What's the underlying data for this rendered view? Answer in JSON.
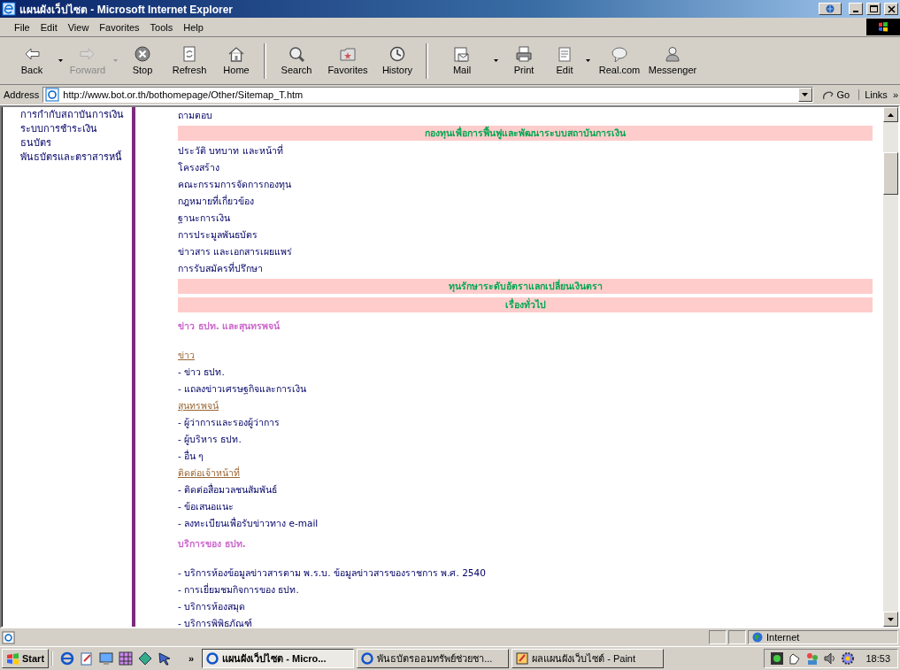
{
  "window": {
    "title": "แผนผังเว็ปไซต - Microsoft Internet Explorer"
  },
  "menu": [
    "File",
    "Edit",
    "View",
    "Favorites",
    "Tools",
    "Help"
  ],
  "toolbar": {
    "buttons": [
      {
        "label": "Back",
        "disabled": false,
        "dropdown": true
      },
      {
        "label": "Forward",
        "disabled": true,
        "dropdown": true
      },
      {
        "label": "Stop",
        "disabled": false,
        "dropdown": false
      },
      {
        "label": "Refresh",
        "disabled": false,
        "dropdown": false
      },
      {
        "label": "Home",
        "disabled": false,
        "dropdown": false
      },
      {
        "label": "Search",
        "disabled": false,
        "dropdown": false
      },
      {
        "label": "Favorites",
        "disabled": false,
        "dropdown": false
      },
      {
        "label": "History",
        "disabled": false,
        "dropdown": false
      },
      {
        "label": "Mail",
        "disabled": false,
        "dropdown": true
      },
      {
        "label": "Print",
        "disabled": false,
        "dropdown": false
      },
      {
        "label": "Edit",
        "disabled": false,
        "dropdown": true
      },
      {
        "label": "Real.com",
        "disabled": false,
        "dropdown": false
      },
      {
        "label": "Messenger",
        "disabled": false,
        "dropdown": false
      }
    ]
  },
  "address": {
    "label": "Address",
    "url": "http://www.bot.or.th/bothomepage/Other/Sitemap_T.htm",
    "go": "Go",
    "links": "Links",
    "links_more": "»"
  },
  "sidebar": {
    "items": [
      "การกำกับสถาบันการเงิน",
      "ระบบการชำระเงิน",
      "ธนบัตร",
      "พันธบัตรและตราสารหนี้"
    ]
  },
  "content": [
    {
      "kind": "text",
      "text": "ถามตอบ"
    },
    {
      "kind": "band",
      "text": "กองทุนเพื่อการฟื้นฟูและพัฒนาระบบสถาบันการเงิน"
    },
    {
      "kind": "text",
      "text": "ประวัติ บทบาท และหน้าที่"
    },
    {
      "kind": "text",
      "text": "โครงสร้าง"
    },
    {
      "kind": "text",
      "text": "คณะกรรมการจัดการกองทุน"
    },
    {
      "kind": "text",
      "text": "กฎหมายที่เกี่ยวข้อง"
    },
    {
      "kind": "text",
      "text": "ฐานะการเงิน"
    },
    {
      "kind": "text",
      "text": "การประมูลพันธบัตร"
    },
    {
      "kind": "text",
      "text": "ข่าวสาร และเอกสารเผยแพร่"
    },
    {
      "kind": "text",
      "text": "การรับสมัครที่ปรึกษา"
    },
    {
      "kind": "band",
      "text": "ทุนรักษาระดับอัตราแลกเปลี่ยนเงินตรา"
    },
    {
      "kind": "band",
      "text": "เรื่องทั่วไป"
    },
    {
      "kind": "heading",
      "text": "ข่าว ธปท. และสุนทรพจน์"
    },
    {
      "kind": "link",
      "text": "ข่าว"
    },
    {
      "kind": "text",
      "text": "- ข่าว ธปท."
    },
    {
      "kind": "text",
      "text": "- แถลงข่าวเศรษฐกิจและการเงิน"
    },
    {
      "kind": "link",
      "text": "สุนทรพจน์"
    },
    {
      "kind": "text",
      "text": "- ผู้ว่าการและรองผู้ว่าการ"
    },
    {
      "kind": "text",
      "text": "- ผู้บริหาร ธปท."
    },
    {
      "kind": "text",
      "text": "- อื่น ๆ"
    },
    {
      "kind": "link",
      "text": "ติดต่อเจ้าหน้าที่"
    },
    {
      "kind": "text",
      "text": "- ติดต่อสื่อมวลชนสัมพันธ์"
    },
    {
      "kind": "text",
      "text": "- ข้อเสนอแนะ"
    },
    {
      "kind": "text",
      "text": "- ลงทะเบียนเพื่อรับข่าวทาง e-mail"
    },
    {
      "kind": "heading",
      "text": "บริการของ ธปท."
    },
    {
      "kind": "text",
      "text": "- บริการห้องข้อมูลข่าวสารตาม พ.ร.บ. ข้อมูลข่าวสารของราชการ  พ.ศ. 2540"
    },
    {
      "kind": "text",
      "text": "- การเยี่ยมชมกิจการของ ธปท."
    },
    {
      "kind": "text",
      "text": "- บริการห้องสมุด"
    },
    {
      "kind": "text",
      "text": "- บริการพิพิธภัณฑ์"
    }
  ],
  "status_bar": {
    "zone": "Internet"
  },
  "taskbar": {
    "start": "Start",
    "more": "»",
    "tasks": [
      {
        "label": "แผนผังเว็ปไซต - Micro...",
        "selected": true
      },
      {
        "label": "พันธบัตรออมทรัพย์ช่วยชา...",
        "selected": false
      },
      {
        "label": "ผลแผนผังเว็บไซต์ - Paint",
        "selected": false
      }
    ],
    "clock": "18:53"
  }
}
